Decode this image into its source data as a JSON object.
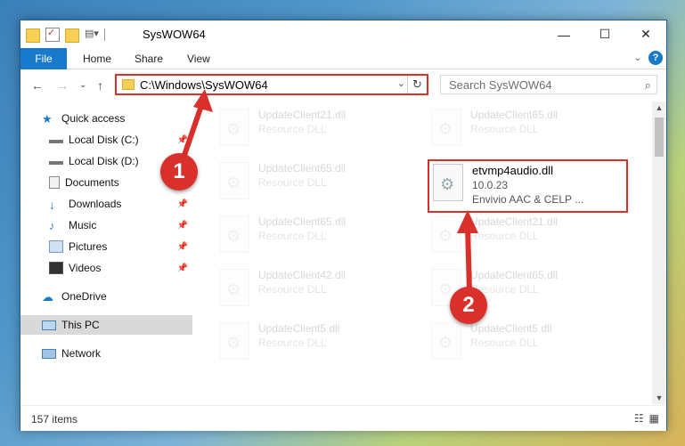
{
  "window": {
    "title": "SysWOW64",
    "controls": {
      "minimize": "—",
      "maximize": "☐",
      "close": "✕"
    }
  },
  "ribbon": {
    "tabs": [
      "File",
      "Home",
      "Share",
      "View"
    ],
    "help": "?"
  },
  "address": {
    "path": "C:\\Windows\\SysWOW64",
    "search_placeholder": "Search SysWOW64"
  },
  "sidebar": {
    "items": [
      {
        "label": "Quick access",
        "icon": "star-icon"
      },
      {
        "label": "Local Disk (C:)",
        "icon": "drive-icon"
      },
      {
        "label": "Local Disk (D:)",
        "icon": "drive-icon"
      },
      {
        "label": "Documents",
        "icon": "documents-icon"
      },
      {
        "label": "Downloads",
        "icon": "download-icon"
      },
      {
        "label": "Music",
        "icon": "music-icon"
      },
      {
        "label": "Pictures",
        "icon": "pictures-icon"
      },
      {
        "label": "Videos",
        "icon": "videos-icon"
      },
      {
        "label": "OneDrive",
        "icon": "cloud-icon"
      },
      {
        "label": "This PC",
        "icon": "computer-icon"
      },
      {
        "label": "Network",
        "icon": "network-icon"
      }
    ]
  },
  "files": [
    {
      "name": "UpdateClient21.dll",
      "type": "Resource DLL"
    },
    {
      "name": "UpdateClient65.dll",
      "type": "Resource DLL"
    },
    {
      "name": "UpdateClient65.dll",
      "type": "Resource DLL"
    },
    {
      "name": "etvmp4audio.dll",
      "version": "10.0.23",
      "desc": "Envivio AAC & CELP ..."
    },
    {
      "name": "UpdateClient65.dll",
      "type": "Resource DLL"
    },
    {
      "name": "UpdateClient21.dll",
      "type": "Resource DLL"
    },
    {
      "name": "UpdateClient42.dll",
      "type": "Resource DLL"
    },
    {
      "name": "UpdateClient65.dll",
      "type": "Resource DLL"
    },
    {
      "name": "UpdateClient5.dll",
      "type": "Resource DLL"
    },
    {
      "name": "UpdateClient5.dll",
      "type": "Resource DLL"
    }
  ],
  "status": {
    "item_count": "157 items"
  },
  "callouts": {
    "one": "1",
    "two": "2"
  },
  "colors": {
    "accent": "#1979ca",
    "highlight": "#d9302c"
  }
}
